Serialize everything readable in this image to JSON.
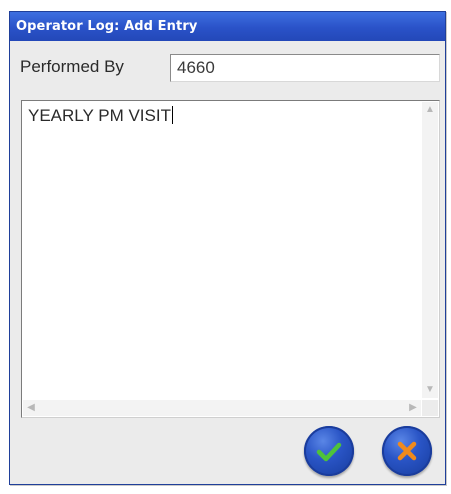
{
  "dialog": {
    "title": "Operator Log: Add Entry",
    "performed_by_label": "Performed By",
    "performed_by_value": "4660",
    "notes_value": "YEARLY PM VISIT",
    "ok_icon": "checkmark-icon",
    "cancel_icon": "x-icon"
  },
  "colors": {
    "title_bar": "#2a52c8",
    "dialog_bg": "#ebebeb",
    "button_blue": "#2a55c6",
    "ok_check": "#4fc23a",
    "cancel_x": "#f08a1c"
  }
}
